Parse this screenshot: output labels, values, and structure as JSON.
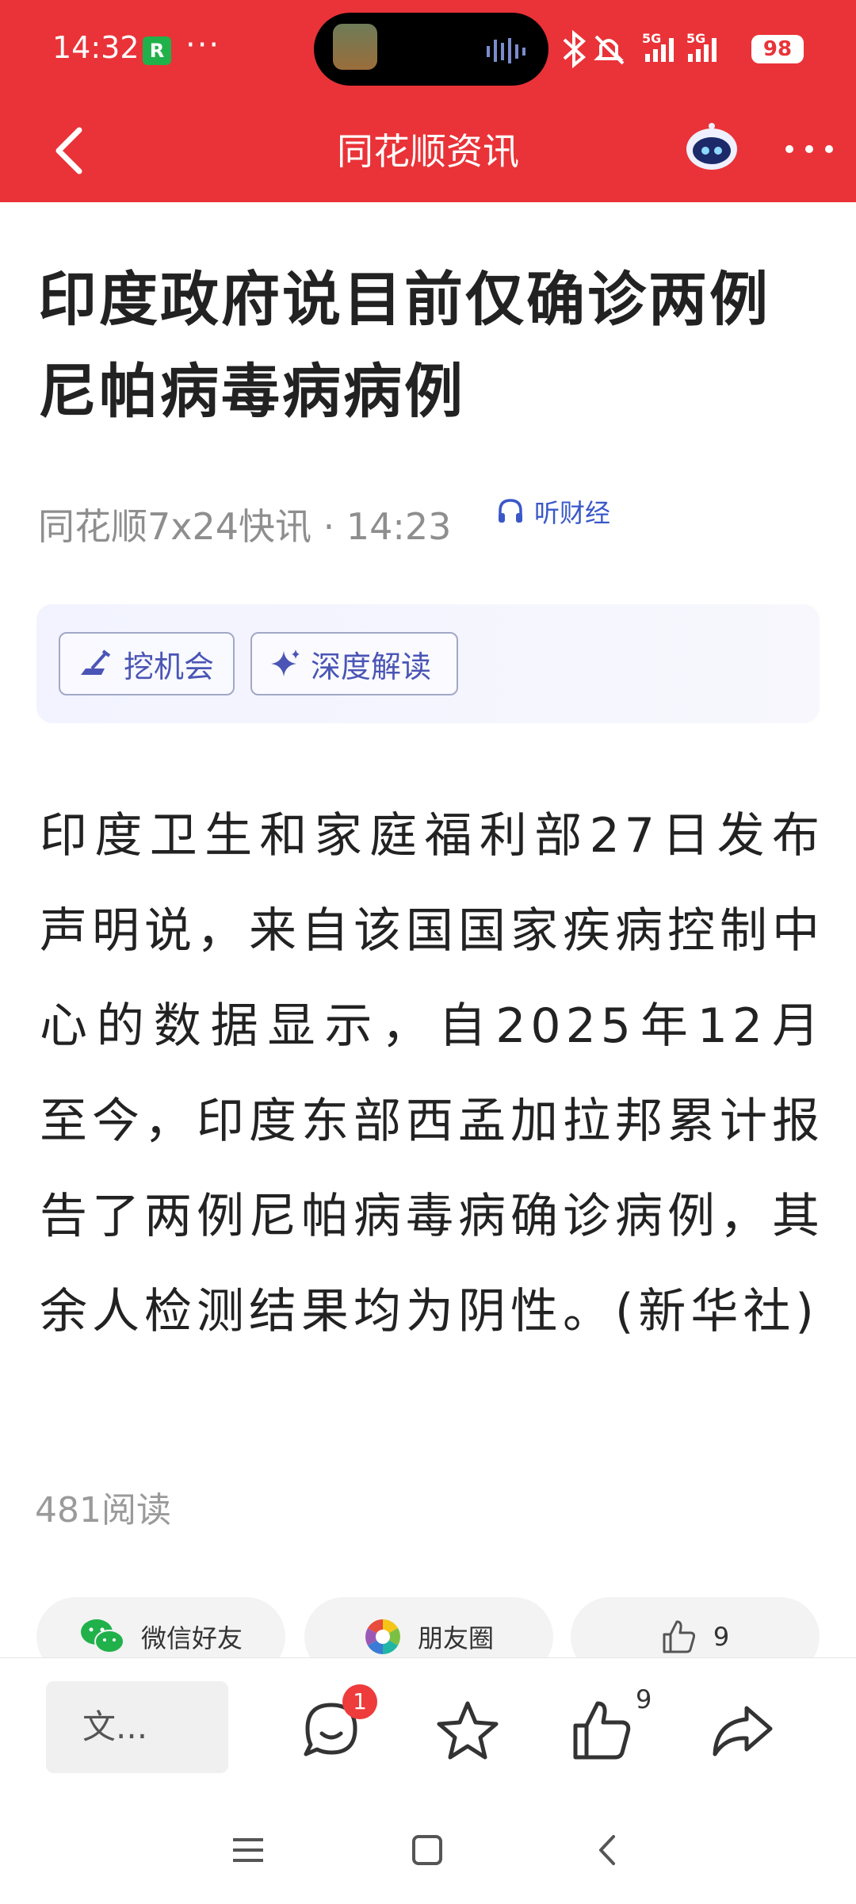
{
  "status_bar": {
    "time": "14:32",
    "app_icon_label": "R",
    "more": "···",
    "battery": "98"
  },
  "header": {
    "title": "同花顺资讯"
  },
  "article": {
    "title": "印度政府说目前仅确诊两例尼帕病毒病病例",
    "source": "同花顺7x24快讯 · 14:23",
    "listen_label": "听财经",
    "chips": [
      {
        "label": "挖机会",
        "icon": "shovel-icon"
      },
      {
        "label": "深度解读",
        "icon": "sparkle-icon"
      }
    ],
    "body": "印度卫生和家庭福利部27日发布声明说，来自该国国家疾病控制中心的数据显示，自2025年12月至今，印度东部西孟加拉邦累计报告了两例尼帕病毒病确诊病例，其余人检测结果均为阴性。(新华社)",
    "reads": "481阅读"
  },
  "share": {
    "wechat_label": "微信好友",
    "moments_label": "朋友圈",
    "like_count": "9"
  },
  "bottom_bar": {
    "comment_placeholder": "文...",
    "comment_badge": "1",
    "like_badge": "9"
  },
  "colors": {
    "brand_red": "#e93338",
    "accent_blue": "#3a58c8"
  }
}
